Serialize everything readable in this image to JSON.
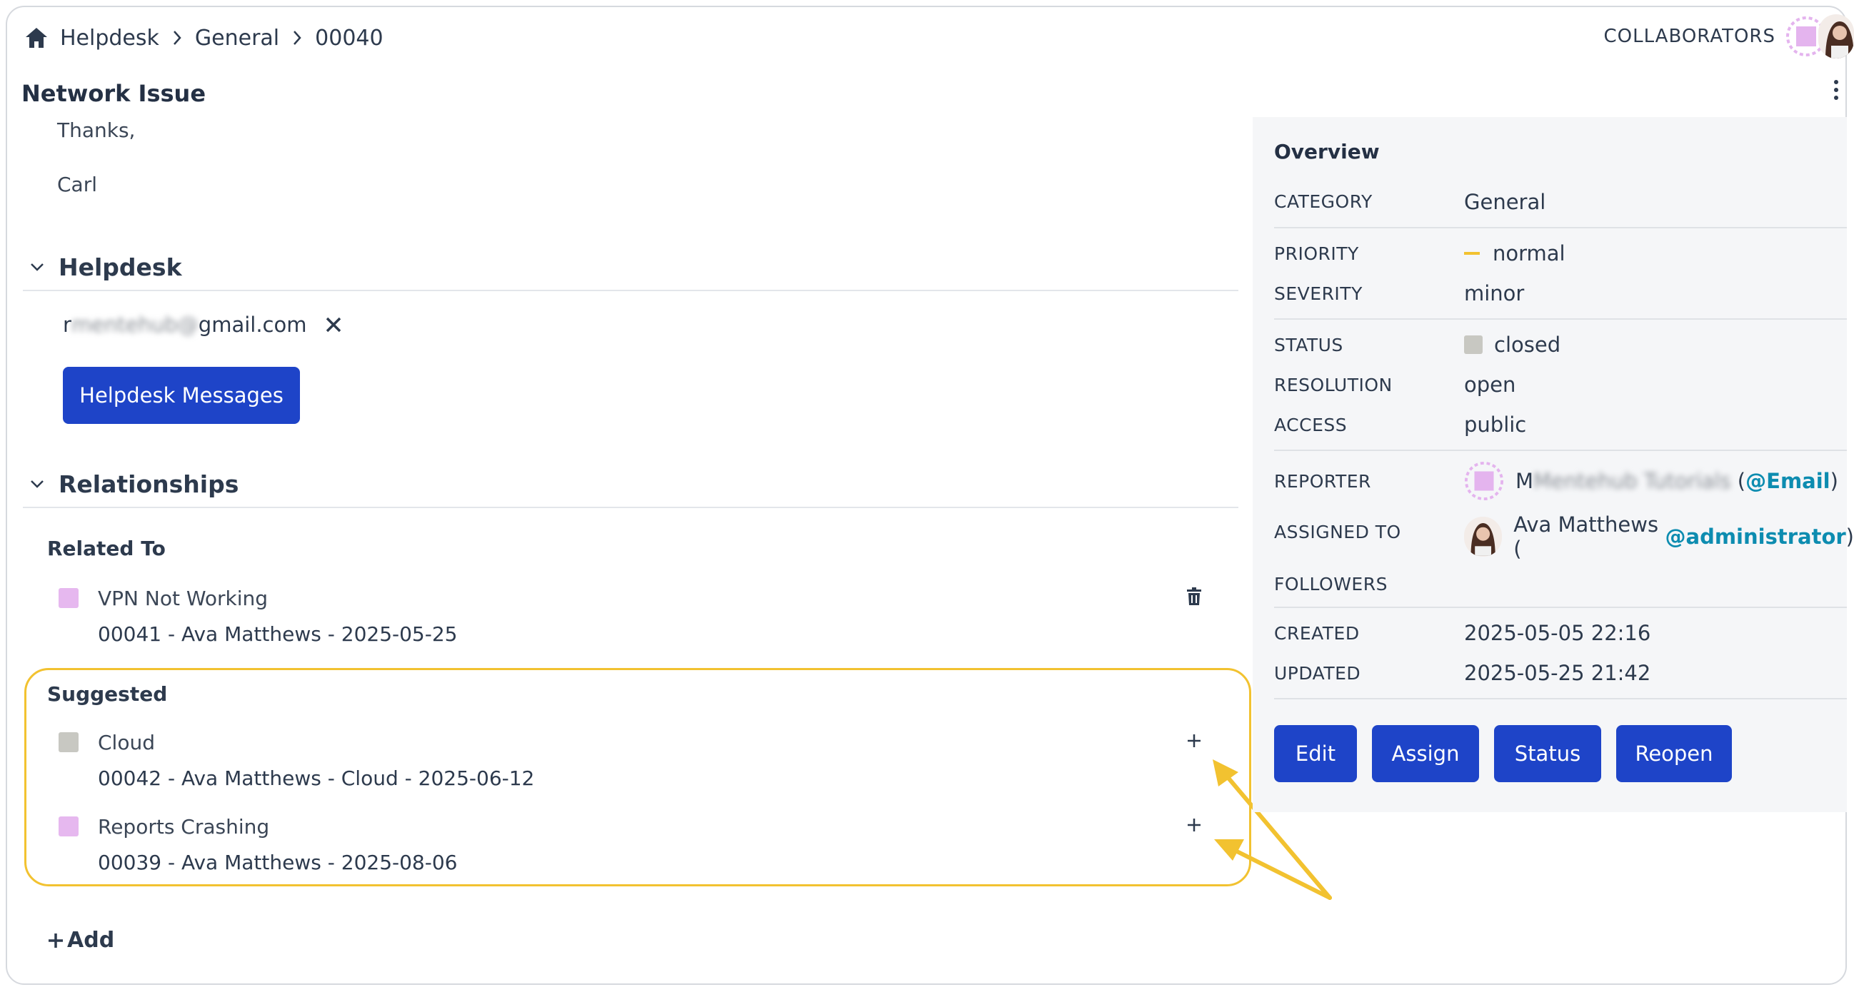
{
  "breadcrumb": {
    "items": [
      "Helpdesk",
      "General",
      "00040"
    ]
  },
  "header": {
    "collaborators_label": "COLLABORATORS"
  },
  "issue": {
    "title": "Network Issue",
    "body_lines": [
      "Thanks,",
      "Carl"
    ]
  },
  "helpdesk": {
    "section_title": "Helpdesk",
    "email_hidden": "mentehub@",
    "email_prefix": "r",
    "email_visible": "gmail.com",
    "messages_button": "Helpdesk Messages"
  },
  "relationships": {
    "section_title": "Relationships",
    "related_label": "Related To",
    "related": [
      {
        "name": "VPN Not Working",
        "meta": "00041 - Ava Matthews - 2025-05-25",
        "color": "#e6b8ef"
      }
    ],
    "suggested_label": "Suggested",
    "suggested": [
      {
        "name": "Cloud",
        "meta": "00042 - Ava Matthews - Cloud - 2025-06-12",
        "color": "#c8c8c2"
      },
      {
        "name": "Reports Crashing",
        "meta": "00039 - Ava Matthews - 2025-08-06",
        "color": "#e6b8ef"
      }
    ],
    "add_label": "Add"
  },
  "overview": {
    "title": "Overview",
    "rows": {
      "category": {
        "label": "CATEGORY",
        "value": "General"
      },
      "priority": {
        "label": "PRIORITY",
        "value": "normal"
      },
      "severity": {
        "label": "SEVERITY",
        "value": "minor"
      },
      "status": {
        "label": "STATUS",
        "value": "closed"
      },
      "resolution": {
        "label": "RESOLUTION",
        "value": "open"
      },
      "access": {
        "label": "ACCESS",
        "value": "public"
      },
      "reporter": {
        "label": "REPORTER",
        "name_prefix": "M",
        "name_hidden": "Mentehub Tutorials",
        "open": " (",
        "mention": "@Email",
        "close": ")"
      },
      "assigned": {
        "label": "ASSIGNED TO",
        "name": "Ava Matthews (",
        "mention": "@administrator",
        "close": ")"
      },
      "followers": {
        "label": "FOLLOWERS"
      },
      "created": {
        "label": "CREATED",
        "value": "2025-05-05 22:16"
      },
      "updated": {
        "label": "UPDATED",
        "value": "2025-05-25 21:42"
      }
    },
    "buttons": {
      "edit": "Edit",
      "assign": "Assign",
      "status": "Status",
      "reopen": "Reopen"
    }
  },
  "colors": {
    "accent": "#1e44c8",
    "highlight": "#f2c230",
    "mention": "#0d8cb0",
    "priority_normal": "#f2c230"
  }
}
